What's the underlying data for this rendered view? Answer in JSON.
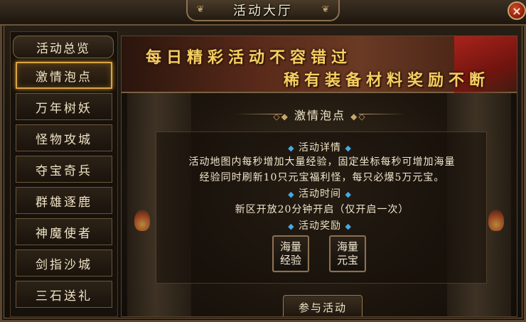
{
  "window": {
    "title": "活动大厅",
    "close_label": "×"
  },
  "sidebar": {
    "header": "活动总览",
    "items": [
      {
        "label": "激情泡点",
        "active": true
      },
      {
        "label": "万年树妖",
        "active": false
      },
      {
        "label": "怪物攻城",
        "active": false
      },
      {
        "label": "夺宝奇兵",
        "active": false
      },
      {
        "label": "群雄逐鹿",
        "active": false
      },
      {
        "label": "神魔使者",
        "active": false
      },
      {
        "label": "剑指沙城",
        "active": false
      },
      {
        "label": "三石送礼",
        "active": false
      }
    ]
  },
  "banner": {
    "line1": "每日精彩活动不容错过",
    "line2": "稀有装备材料奖励不断"
  },
  "activity": {
    "name": "激情泡点",
    "details_heading": "活动详情",
    "details_line1": "活动地图内每秒增加大量经验，固定坐标每秒可增加海量",
    "details_line2": "经验同时刷新10只元宝福利怪，每只必爆5万元宝。",
    "time_heading": "活动时间",
    "time_text": "新区开放20分钟开启（仅开启一次）",
    "reward_heading": "活动奖励",
    "rewards": [
      {
        "line1": "海量",
        "line2": "经验"
      },
      {
        "line1": "海量",
        "line2": "元宝"
      }
    ],
    "join_label": "参与活动"
  },
  "colors": {
    "accent_gold": "#f6cf62",
    "active_border": "#d9a541",
    "diamond_blue": "#4aa8e0",
    "close_red": "#8a1d0c"
  }
}
